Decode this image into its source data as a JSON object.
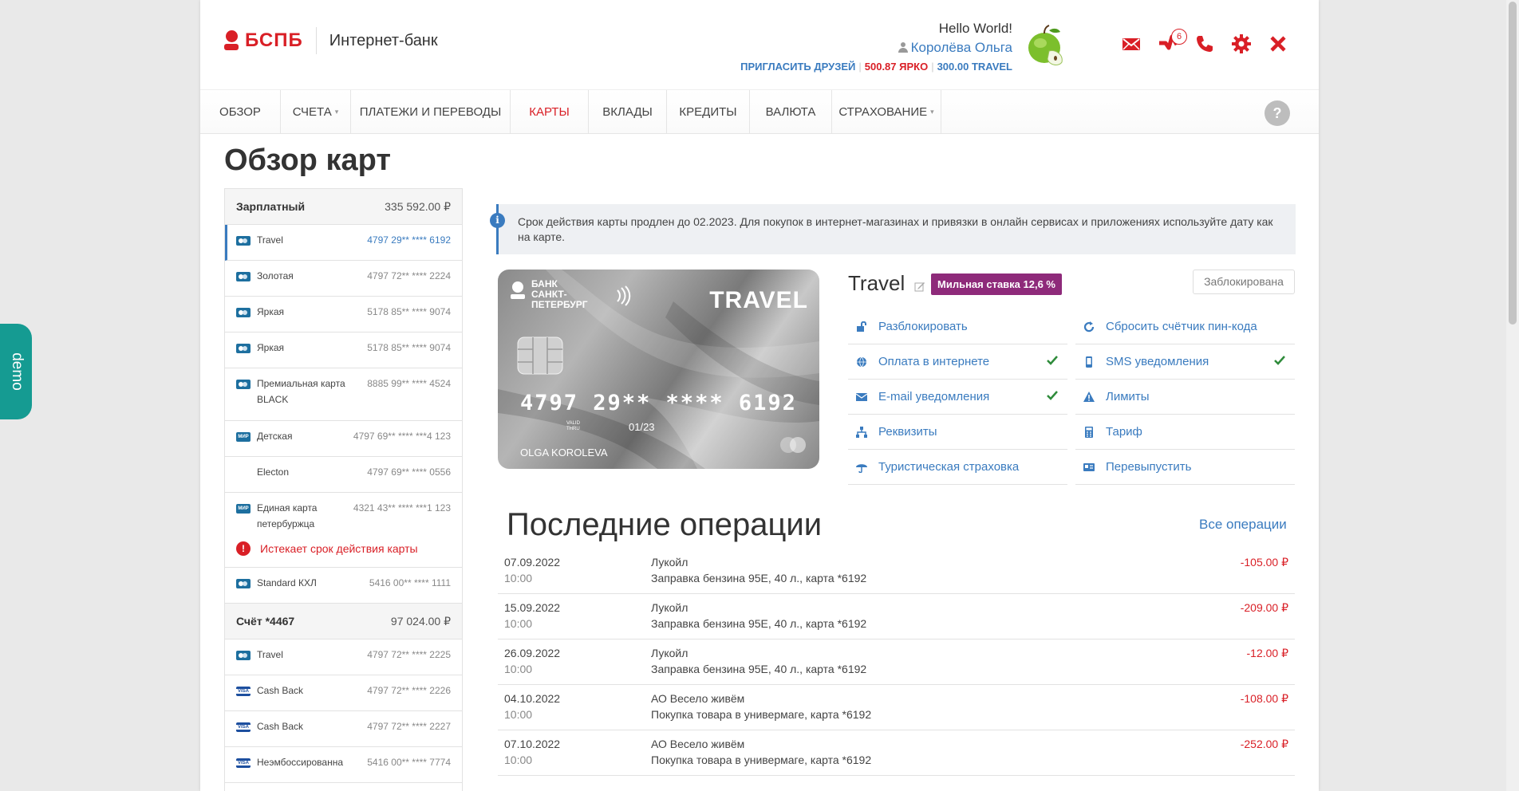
{
  "header": {
    "logo_text": "БСПБ",
    "subtitle": "Интернет-банк",
    "greeting": "Hello World!",
    "user_name": "Королёва Ольга",
    "invite_link": "ПРИГЛАСИТЬ ДРУЗЕЙ",
    "bonus_yarko": "500.87 ЯРКО",
    "bonus_travel": "300.00 TRAVEL",
    "notifications_count": "6",
    "icons": [
      "mail-icon",
      "notifications-icon",
      "phone-icon",
      "settings-icon",
      "close-icon"
    ]
  },
  "nav": {
    "items": [
      "ОБЗОР",
      "СЧЕТА",
      "ПЛАТЕЖИ И ПЕРЕВОДЫ",
      "КАРТЫ",
      "ВКЛАДЫ",
      "КРЕДИТЫ",
      "ВАЛЮТА",
      "СТРАХОВАНИЕ"
    ],
    "active": "КАРТЫ",
    "help": "?"
  },
  "page_title": "Обзор карт",
  "sidebar": {
    "groups": [
      {
        "account": "Зарплатный",
        "balance": "335 592.00 ₽",
        "cards": [
          {
            "name": "Travel",
            "number": "4797 29** **** 6192",
            "icon": "mastercard-icon",
            "selected": true
          },
          {
            "name": "Золотая",
            "number": "4797 72** **** 2224",
            "icon": "mastercard-icon"
          },
          {
            "name": "Яркая",
            "number": "5178 85** **** 9074",
            "icon": "mastercard-icon"
          },
          {
            "name": "Яркая",
            "number": "5178 85** **** 9074",
            "icon": "mastercard-icon"
          },
          {
            "name": "Премиальная карта BLACK",
            "number": "8885 99** **** 4524",
            "icon": "mastercard-icon"
          },
          {
            "name": "Детская",
            "number": "4797 69** **** ***4 123",
            "icon": "mir-icon"
          },
          {
            "name": "Electon",
            "number": "4797 69** **** 0556",
            "icon": "none"
          },
          {
            "name": "Единая карта петербуржца",
            "number": "4321 43** **** ***1 123",
            "icon": "mir-icon",
            "warning": "Истекает срок действия карты"
          },
          {
            "name": "Standard КХЛ",
            "number": "5416 00** **** 1111",
            "icon": "mastercard-icon"
          }
        ]
      },
      {
        "account": "Счёт *4467",
        "balance": "97 024.00 ₽",
        "cards": [
          {
            "name": "Travel",
            "number": "4797 72** **** 2225",
            "icon": "mastercard-icon"
          },
          {
            "name": "Cash Back",
            "number": "4797 72** **** 2226",
            "icon": "visa-icon"
          },
          {
            "name": "Cash Back",
            "number": "4797 72** **** 2227",
            "icon": "visa-icon"
          },
          {
            "name": "Неэмбоссированна",
            "number": "5416 00** **** 7774",
            "icon": "visa-icon"
          }
        ]
      }
    ]
  },
  "info_banner": "Срок действия карты продлен до 02.2023. Для покупок в интернет-магазинах и привязки в онлайн сервисах и приложениях используйте дату как на карте.",
  "card_image": {
    "bank_line1": "БАНК",
    "bank_line2": "САНКТ-",
    "bank_line3": "ПЕТЕРБУРГ",
    "brand": "TRAVEL",
    "number": "4797 29** **** 6192",
    "valid_label_1": "VALID",
    "valid_label_2": "THRU",
    "expiry": "01/23",
    "holder": "OLGA KOROLEVA"
  },
  "card_detail": {
    "name": "Travel",
    "rate_badge": "Мильная ставка 12,6 %",
    "status": "Заблокирована",
    "actions": [
      {
        "label": "Разблокировать",
        "icon": "unlock-icon",
        "checked": false
      },
      {
        "label": "Сбросить счётчик пин-кода",
        "icon": "refresh-icon",
        "checked": false
      },
      {
        "label": "Оплата в интернете",
        "icon": "globe-icon",
        "checked": true
      },
      {
        "label": "SMS уведомления",
        "icon": "mobile-icon",
        "checked": true
      },
      {
        "label": "E-mail уведомления",
        "icon": "envelope-icon",
        "checked": true
      },
      {
        "label": "Лимиты",
        "icon": "warning-icon",
        "checked": false
      },
      {
        "label": "Реквизиты",
        "icon": "sitemap-icon",
        "checked": false
      },
      {
        "label": "Тариф",
        "icon": "calculator-icon",
        "checked": false
      },
      {
        "label": "Туристическая страховка",
        "icon": "umbrella-icon",
        "checked": false
      },
      {
        "label": "Перевыпустить",
        "icon": "id-card-icon",
        "checked": false
      }
    ]
  },
  "operations": {
    "title": "Последние операции",
    "all_link": "Все операции",
    "items": [
      {
        "date": "07.09.2022",
        "time": "10:00",
        "merchant": "Лукойл",
        "desc": "Заправка бензина 95Е, 40 л., карта *6192",
        "amount": "-105.00 ₽"
      },
      {
        "date": "15.09.2022",
        "time": "10:00",
        "merchant": "Лукойл",
        "desc": "Заправка бензина 95Е, 40 л., карта *6192",
        "amount": "-209.00 ₽"
      },
      {
        "date": "26.09.2022",
        "time": "10:00",
        "merchant": "Лукойл",
        "desc": "Заправка бензина 95Е, 40 л., карта *6192",
        "amount": "-12.00 ₽"
      },
      {
        "date": "04.10.2022",
        "time": "10:00",
        "merchant": "АО Весело живём",
        "desc": "Покупка товара в универмаге, карта *6192",
        "amount": "-108.00 ₽"
      },
      {
        "date": "07.10.2022",
        "time": "10:00",
        "merchant": "АО Весело живём",
        "desc": "Покупка товара в универмаге, карта *6192",
        "amount": "-252.00 ₽"
      }
    ]
  },
  "demo_tab": "demo",
  "colors": {
    "brand_red": "#d91f26",
    "link_blue": "#3a7bbf",
    "rate_purple": "#8e2a7a",
    "demo_teal": "#159b92"
  }
}
